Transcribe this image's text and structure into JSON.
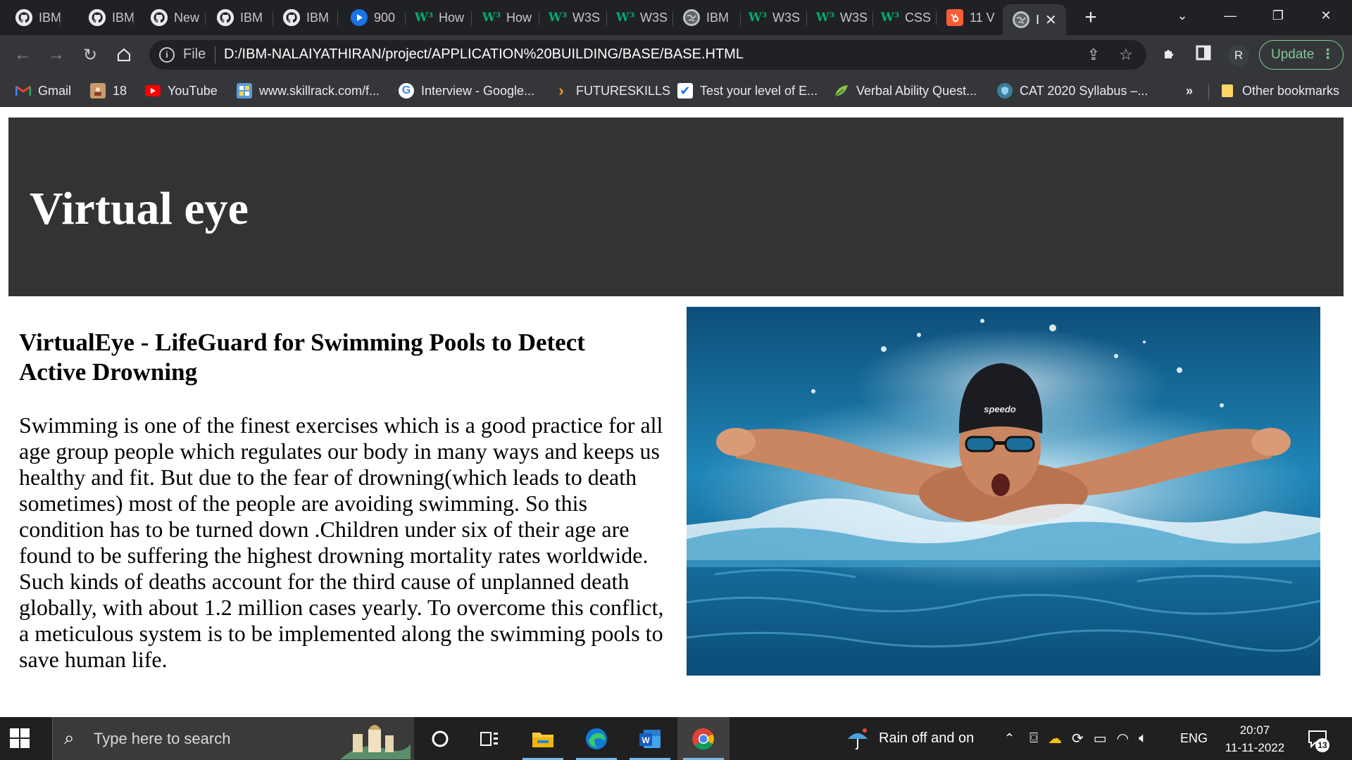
{
  "tabs": [
    {
      "label": "IBM",
      "icon": "github-icon"
    },
    {
      "label": "IBM",
      "icon": "github-icon"
    },
    {
      "label": "New",
      "icon": "github-icon"
    },
    {
      "label": "IBM",
      "icon": "github-icon"
    },
    {
      "label": "IBM",
      "icon": "github-icon"
    },
    {
      "label": "900",
      "icon": "blue-play-icon"
    },
    {
      "label": "How",
      "icon": "w3schools-icon"
    },
    {
      "label": "How",
      "icon": "w3schools-icon"
    },
    {
      "label": "W3S",
      "icon": "w3schools-icon"
    },
    {
      "label": "W3S",
      "icon": "w3schools-icon"
    },
    {
      "label": "IBM",
      "icon": "globe-icon"
    },
    {
      "label": "W3S",
      "icon": "w3schools-icon"
    },
    {
      "label": "W3S",
      "icon": "w3schools-icon"
    },
    {
      "label": "CSS",
      "icon": "w3schools-icon"
    },
    {
      "label": "11 V",
      "icon": "hubspot-icon"
    },
    {
      "label": "I",
      "icon": "globe-icon",
      "active": true
    }
  ],
  "toolbar": {
    "file_label": "File",
    "url": "D:/IBM-NALAIYATHIRAN/project/APPLICATION%20BUILDING/BASE/BASE.HTML",
    "profile_initial": "R",
    "update_label": "Update"
  },
  "bookmarks": [
    {
      "label": "Gmail",
      "icon": "gmail-icon"
    },
    {
      "label": "18",
      "icon": "avatar-icon"
    },
    {
      "label": "YouTube",
      "icon": "youtube-icon"
    },
    {
      "label": "www.skillrack.com/f...",
      "icon": "skillrack-icon"
    },
    {
      "label": "Interview - Google...",
      "icon": "google-icon"
    },
    {
      "label": "FUTURESKILLS",
      "icon": "chevron-icon"
    },
    {
      "label": "Test your level of E...",
      "icon": "checkbox-icon"
    },
    {
      "label": "Verbal Ability Quest...",
      "icon": "leaf-icon"
    },
    {
      "label": "CAT 2020 Syllabus –...",
      "icon": "shield-icon"
    }
  ],
  "bookmarks_more": "»",
  "other_bookmarks": "Other bookmarks",
  "page": {
    "hero_title": "Virtual eye",
    "heading": "VirtualEye - LifeGuard for Swimming Pools to Detect Active Drowning",
    "body": "Swimming is one of the finest exercises which is a good practice for all age group people which regulates our body in many ways and keeps us healthy and fit. But due to the fear of drowning(which leads to death sometimes) most of the people are avoiding swimming. So this condition has to be turned down .Children under six of their age are found to be suffering the highest drowning mortality rates worldwide. Such kinds of deaths account for the third cause of unplanned death globally, with about 1.2 million cases yearly. To overcome this conflict, a meticulous system is to be implemented along the swimming pools to save human life.",
    "image_alt": "Swimmer doing butterfly stroke in a pool",
    "cap_brand": "speedo"
  },
  "taskbar": {
    "search_placeholder": "Type here to search",
    "weather": "Rain off and on",
    "language": "ENG",
    "time": "20:07",
    "date": "11-11-2022",
    "notifications": "13"
  },
  "colors": {
    "hero_bg": "#333333",
    "tabstrip_bg": "#202124",
    "toolbar_bg": "#35363a",
    "update_green": "#81c995"
  }
}
